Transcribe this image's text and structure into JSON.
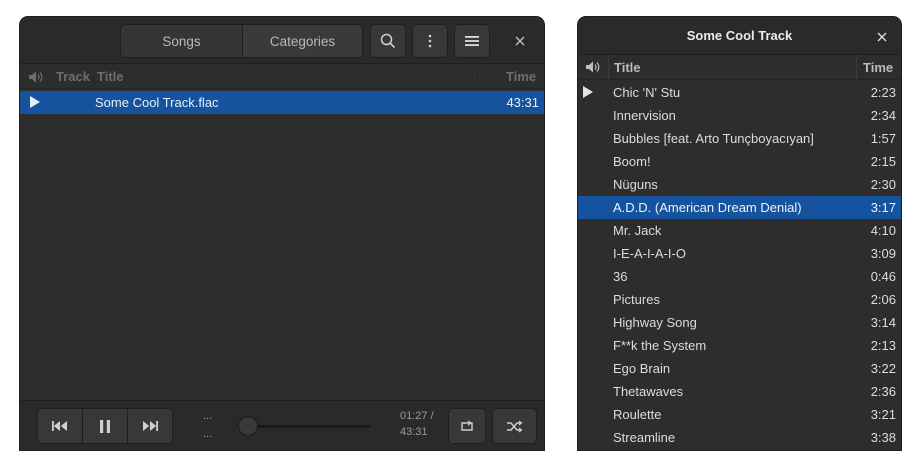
{
  "player": {
    "tabs": [
      "Songs",
      "Categories"
    ],
    "columns": {
      "track": "Track",
      "title": "Title",
      "time": "Time"
    },
    "song": {
      "title": "Some Cool Track.flac",
      "time": "43:31"
    },
    "now_playing": {
      "line1": "...",
      "line2": "..."
    },
    "position": "01:27 /",
    "duration": "43:31",
    "progress": 0.033
  },
  "mini": {
    "title": "Some Cool Track",
    "columns": {
      "title": "Title",
      "time": "Time"
    },
    "playing_index": 0,
    "selected_index": 5,
    "tracks": [
      {
        "title": "Chic 'N' Stu",
        "time": "2:23"
      },
      {
        "title": "Innervision",
        "time": "2:34"
      },
      {
        "title": "Bubbles [feat. Arto Tunçboyacıyan]",
        "time": "1:57"
      },
      {
        "title": "Boom!",
        "time": "2:15"
      },
      {
        "title": "Nüguns",
        "time": "2:30"
      },
      {
        "title": "A.D.D. (American Dream Denial)",
        "time": "3:17"
      },
      {
        "title": "Mr. Jack",
        "time": "4:10"
      },
      {
        "title": "I-E-A-I-A-I-O",
        "time": "3:09"
      },
      {
        "title": "36",
        "time": "0:46"
      },
      {
        "title": "Pictures",
        "time": "2:06"
      },
      {
        "title": "Highway Song",
        "time": "3:14"
      },
      {
        "title": "F**k the System",
        "time": "2:13"
      },
      {
        "title": "Ego Brain",
        "time": "3:22"
      },
      {
        "title": "Thetawaves",
        "time": "2:36"
      },
      {
        "title": "Roulette",
        "time": "3:21"
      },
      {
        "title": "Streamline",
        "time": "3:38"
      }
    ]
  },
  "colors": {
    "selection": "#15539e",
    "window_bg": "#2d2d2d",
    "header_bg": "#2a2a2a"
  },
  "icons": [
    "search-icon",
    "more-vertical-icon",
    "hamburger-menu-icon",
    "close-icon",
    "speaker-icon",
    "play-icon",
    "previous-icon",
    "pause-icon",
    "next-icon",
    "repeat-icon",
    "shuffle-icon"
  ]
}
